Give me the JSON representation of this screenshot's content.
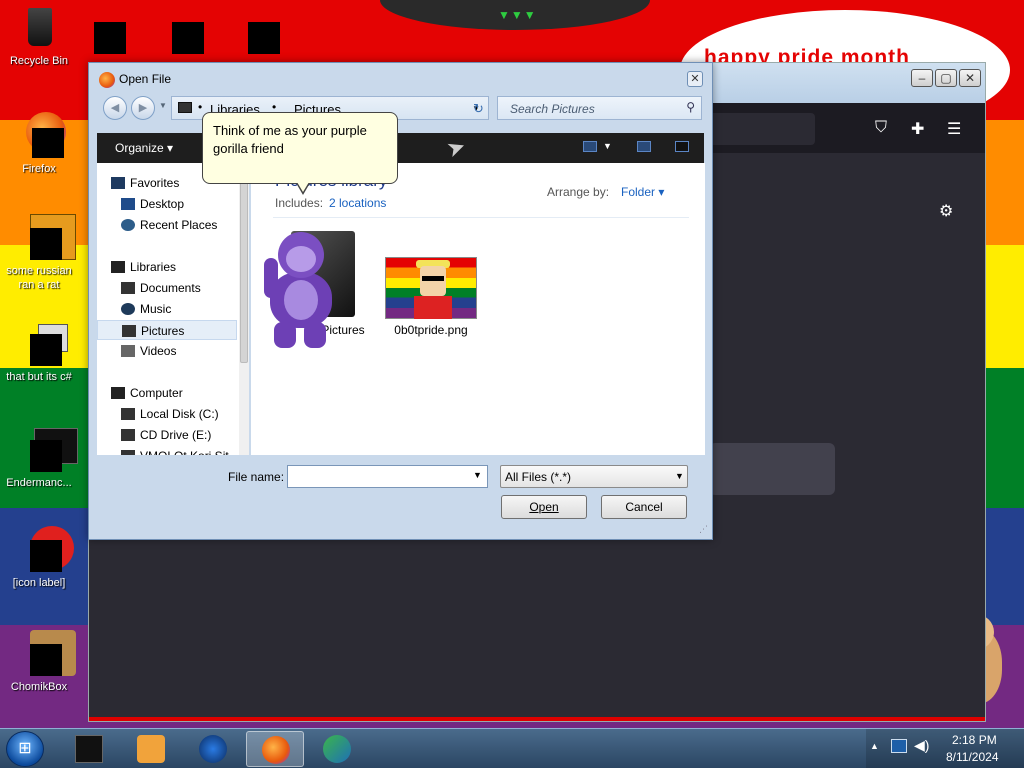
{
  "desktop": {
    "icons": [
      {
        "label": "Recycle Bin"
      },
      {
        "label": "Firefox"
      },
      {
        "label": "some russian ran a rat"
      },
      {
        "label": "that but its c#"
      },
      {
        "label": "Endermanc..."
      },
      {
        "label": "[icon label]"
      },
      {
        "label": "ChomikBox"
      }
    ],
    "bubble_text": "happy pride month"
  },
  "dialog": {
    "title": "Open File",
    "address": {
      "crumb1": "Libraries",
      "crumb2": "Pictures",
      "sep": "•"
    },
    "search_placeholder": "Search Pictures",
    "organize": "Organize",
    "nav": {
      "favorites": "Favorites",
      "desktop": "Desktop",
      "recent": "Recent Places",
      "libraries": "Libraries",
      "documents": "Documents",
      "music": "Music",
      "pictures": "Pictures",
      "videos": "Videos",
      "computer": "Computer",
      "local_disk": "Local Disk (C:)",
      "cd_drive": "CD Drive (E:)",
      "vm_share": "VMOLOt Kori Sit"
    },
    "content": {
      "library_title": "Pictures library",
      "includes_label": "Includes:",
      "includes_link": "2 locations",
      "arrange_label": "Arrange by:",
      "arrange_value": "Folder",
      "files": [
        {
          "name": "Pictures"
        },
        {
          "name": "0b0tpride.png"
        }
      ]
    },
    "tooltip": "Think of me as your purple gorilla friend",
    "filename_label": "File name:",
    "filename_value": "",
    "filetype_value": "All Files (*.*)",
    "open_button": "Open",
    "cancel_button": "Cancel"
  },
  "taskbar": {
    "time": "2:18 PM",
    "date": "8/11/2024"
  },
  "colors": {
    "accent": "#1a62c0",
    "tooltip_bg": "#ffffe1"
  }
}
